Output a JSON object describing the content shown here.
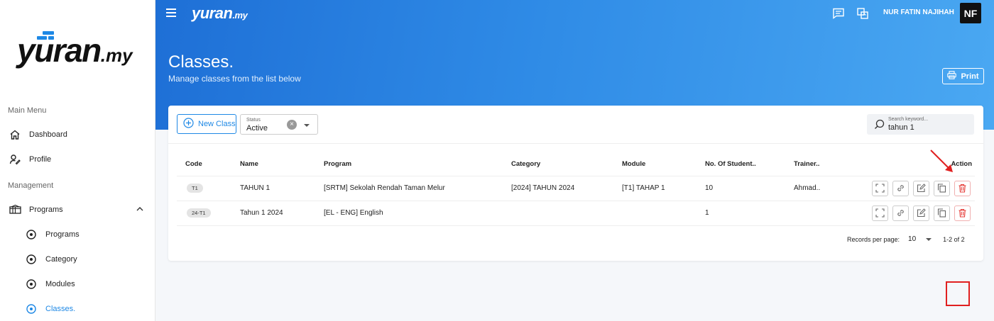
{
  "brand": {
    "logo_main": "yuran",
    "logo_suffix": ".my"
  },
  "sidebar": {
    "main_menu_label": "Main Menu",
    "management_label": "Management",
    "items": [
      {
        "label": "Dashboard",
        "icon": "home-icon"
      },
      {
        "label": "Profile",
        "icon": "profile-icon"
      },
      {
        "label": "Programs",
        "icon": "programs-icon"
      },
      {
        "label": "Programs",
        "icon": "radio-icon"
      },
      {
        "label": "Category",
        "icon": "radio-icon"
      },
      {
        "label": "Modules",
        "icon": "radio-icon"
      },
      {
        "label": "Classes.",
        "icon": "radio-icon"
      }
    ]
  },
  "header": {
    "username": "NUR FATIN NAJIHAH",
    "avatar_initials": "NF",
    "page_title": "Classes.",
    "page_subtitle": "Manage classes from the list below",
    "print_label": "Print"
  },
  "toolbar": {
    "new_class_label": "New Class",
    "status_caption": "Status",
    "status_value": "Active",
    "search_placeholder": "Search keyword...",
    "search_value": "tahun 1"
  },
  "table": {
    "columns": [
      "Code",
      "Name",
      "Program",
      "Category",
      "Module",
      "No. Of Student..",
      "Trainer..",
      "Action"
    ],
    "rows": [
      {
        "code": "T1",
        "name": "TAHUN 1",
        "program": "[SRTM] Sekolah Rendah Taman Melur",
        "category": "[2024] TAHUN 2024",
        "module": "[T1] TAHAP 1",
        "students": "10",
        "trainer": "Ahmad.."
      },
      {
        "code": "24-T1",
        "name": "Tahun 1 2024",
        "program": "[EL - ENG] English",
        "category": "",
        "module": "",
        "students": "1",
        "trainer": ""
      }
    ]
  },
  "pagination": {
    "records_label": "Records per page:",
    "per_page": "10",
    "range": "1-2 of 2"
  },
  "colors": {
    "accent": "#1e88e5",
    "danger": "#e53935",
    "highlight": "#e02020"
  }
}
